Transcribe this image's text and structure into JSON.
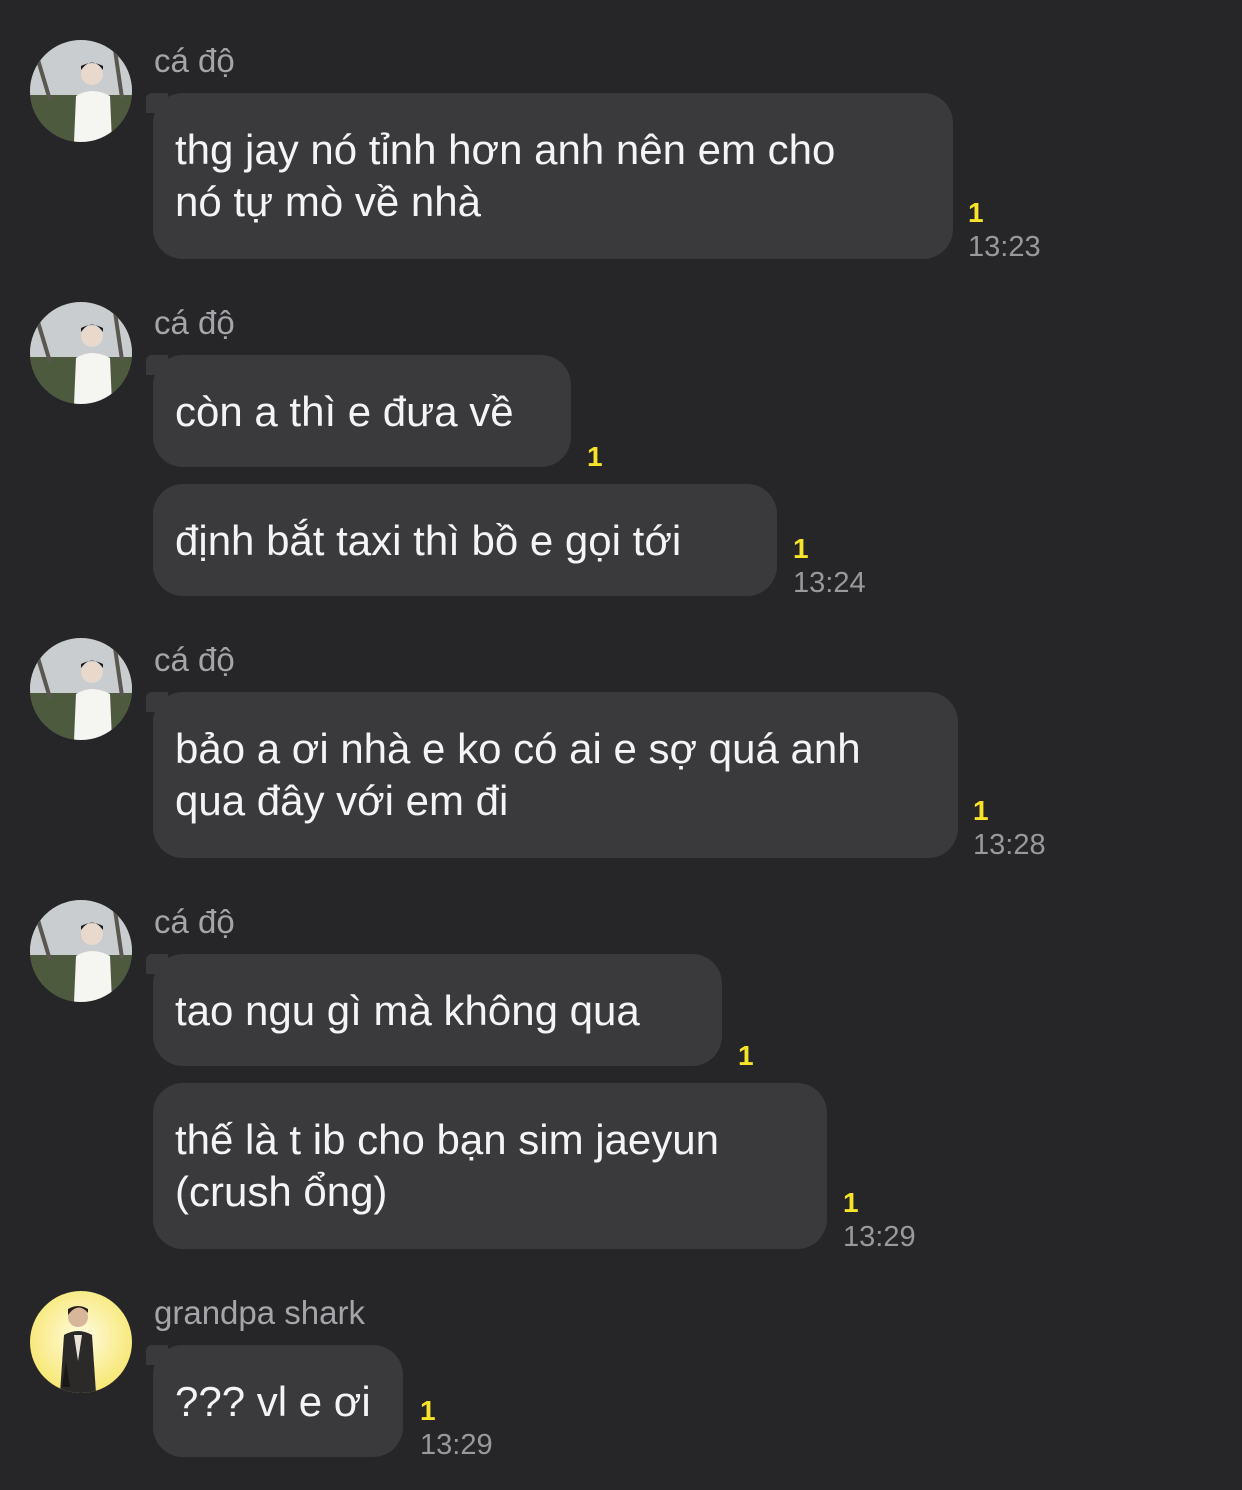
{
  "chat": {
    "groups": [
      {
        "sender": "cá độ",
        "avatar": "person-white-shirt-avatar",
        "messages": [
          {
            "lines": [
              "thg jay nó tỉnh hơn anh nên em cho",
              "nó tự mò về nhà"
            ],
            "unread": "1",
            "time": "13:23"
          }
        ]
      },
      {
        "sender": "cá độ",
        "avatar": "person-white-shirt-avatar",
        "messages": [
          {
            "lines": [
              "còn a thì e đưa về"
            ],
            "unread": "1",
            "time": ""
          },
          {
            "lines": [
              "định bắt taxi thì bồ e gọi tới"
            ],
            "unread": "1",
            "time": "13:24"
          }
        ]
      },
      {
        "sender": "cá độ",
        "avatar": "person-white-shirt-avatar",
        "messages": [
          {
            "lines": [
              "bảo a ơi nhà e ko có ai e sợ quá anh",
              "qua đây với em đi"
            ],
            "unread": "1",
            "time": "13:28"
          }
        ]
      },
      {
        "sender": "cá độ",
        "avatar": "person-white-shirt-avatar",
        "messages": [
          {
            "lines": [
              "tao ngu gì mà không qua"
            ],
            "unread": "1",
            "time": ""
          },
          {
            "lines": [
              "thế là t ib cho bạn sim jaeyun",
              "(crush ổng)"
            ],
            "unread": "1",
            "time": "13:29"
          }
        ]
      },
      {
        "sender": "grandpa shark",
        "avatar": "person-yellow-background-avatar",
        "messages": [
          {
            "lines": [
              "??? vl e ơi"
            ],
            "unread": "1",
            "time": "13:29"
          }
        ]
      }
    ]
  },
  "colors": {
    "background": "#262628",
    "bubble": "#3a3a3c",
    "unread_badge": "#f7e32a",
    "time_text": "#98989d",
    "sender_text": "#a4a4a9"
  }
}
